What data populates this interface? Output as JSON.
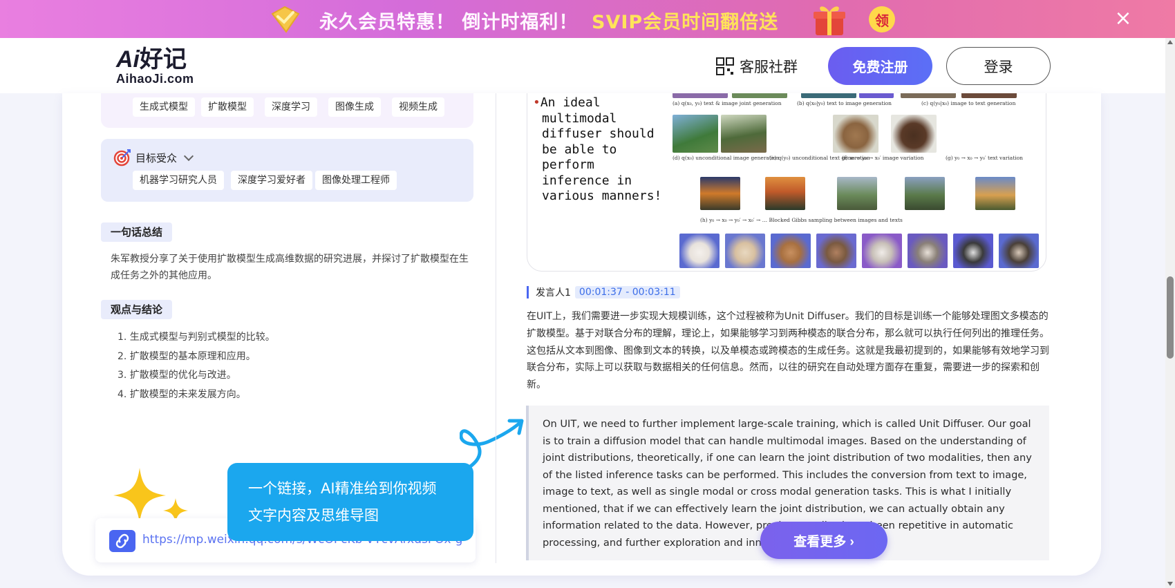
{
  "promo": {
    "text1": "永久会员特惠！ 倒计时福利！",
    "text2": "SVIP会员时间翻倍送",
    "claim": "领",
    "close": "×"
  },
  "header": {
    "logo_main_ai": "Ai",
    "logo_main_cn": "好记",
    "logo_sub": "AihaoJi.com",
    "service_label": "客服社群",
    "register_label": "免费注册",
    "login_label": "登录"
  },
  "keywords": [
    "生成式模型",
    "扩散模型",
    "深度学习",
    "图像生成",
    "视频生成"
  ],
  "audience": {
    "title": "目标受众",
    "tags": [
      "机器学习研究人员",
      "深度学习爱好者",
      "图像处理工程师"
    ]
  },
  "summary": {
    "label": "一句话总结",
    "text": "朱军教授分享了关于使用扩散模型生成高维数据的研究进展，并探讨了扩散模型在生成任务之外的其他应用。"
  },
  "views": {
    "label": "观点与结论",
    "items": [
      "1. 生成式模型与判别式模型的比较。",
      "2. 扩散模型的基本原理和应用。",
      "3. 扩散模型的优化与改进。",
      "4. 扩散模型的未来发展方向。"
    ]
  },
  "promo_bubble": {
    "line1": "一个链接，AI精准给到你视频",
    "line2": "文字内容及思维导图"
  },
  "link_bar": {
    "url": "https://mp.weixin.qq.com/s/WcOPcKb-VYcvArxdsPOx-g"
  },
  "slide": {
    "lines": [
      "An ideal",
      "multimodal",
      "diffuser should",
      "be able to",
      "perform",
      "inference in",
      "various manners!"
    ],
    "captions": {
      "a": "(a) q(x₀, y₀)  text & image joint generation",
      "b": "(b) q(x₀|y₀)  text to image generation",
      "c": "(c) q(y₀|x₀)  image to text generation",
      "d": "(d) q(x₀)  unconditional image generation",
      "e": "(e) q(y₀)  unconditional text generation",
      "f": "(f) x₀ → y₀ → x₀′  image variation",
      "g": "(g) y₀ → x₀ → y₀′  text variation",
      "h": "(h) y₀ → x₀ → y₀′ → x₀′ → …  Blocked Gibbs sampling between images and texts"
    }
  },
  "speaker": {
    "name": "发言人1",
    "time": "00:01:37 - 00:03:11"
  },
  "cn_text": "在UIT上，我们需要进一步实现大规模训练，这个过程被称为Unit Diffuser。我们的目标是训练一个能够处理图文多模态的扩散模型。基于对联合分布的理解，理论上，如果能够学习到两种模态的联合分布，那么就可以执行任何列出的推理任务。这包括从文本到图像、图像到文本的转换，以及单模态或跨模态的生成任务。这就是我最初提到的，如果能够有效地学习到联合分布，实际上可以获取与数据相关的任何信息。然而，以往的研究在自动处理方面存在重复，需要进一步的探索和创新。",
  "en_text": "On UIT, we need to further implement large-scale training, which is called Unit Diffuser. Our goal is to train a diffusion model that can handle multimodal images. Based on the understanding of joint distributions, theoretically, if one can learn the joint distribution of two modalities, then any of the listed inference tasks can be performed. This includes the conversion from text to image, image to text, as well as single modal or cross modal generation tasks. This is what I initially mentioned, that if we can effectively learn the joint distribution, we can actually obtain any information related to the data. However, previous studies have been repetitive in automatic processing, and further exploration and innovation are needed.",
  "more_label": "查看更多 ›",
  "colors": {
    "accent": "#6b5df0",
    "bubble": "#1ba7ee",
    "time_bg": "#e4ebfd"
  }
}
